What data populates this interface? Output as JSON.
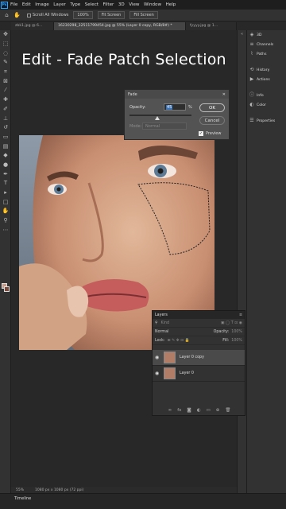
{
  "menubar": {
    "logo": "Ps",
    "items": [
      "File",
      "Edit",
      "Image",
      "Layer",
      "Type",
      "Select",
      "Filter",
      "3D",
      "View",
      "Window",
      "Help"
    ]
  },
  "options_bar": {
    "scroll_all_windows": "Scroll All Windows",
    "zoom_100": "100%",
    "fit_screen": "Fit Screen",
    "fill_screen": "Fill Screen"
  },
  "tabs": [
    {
      "label": "zbk1.jpg @ 6...",
      "active": false
    },
    {
      "label": "16230298_32511799454.jpg @ 55% (Layer 0 copy, RGB/8#) *",
      "active": true
    },
    {
      "label": "fyyyy.jpg @ 1...",
      "active": false
    }
  ],
  "overlay_title": "Edit - Fade Patch Selection",
  "fade_dialog": {
    "title": "Fade",
    "opacity_label": "Opacity:",
    "opacity_value": "45",
    "percent": "%",
    "mode_label": "Mode:",
    "mode_value": "Normal",
    "ok": "OK",
    "cancel": "Cancel",
    "preview": "Preview",
    "preview_checked": true,
    "opacity_fraction": 0.45
  },
  "panels": [
    {
      "icon": "3d-icon",
      "label": "3D"
    },
    {
      "icon": "channels-icon",
      "label": "Channels"
    },
    {
      "icon": "paths-icon",
      "label": "Paths"
    },
    {
      "icon": "history-icon",
      "label": "History"
    },
    {
      "icon": "actions-icon",
      "label": "Actions"
    },
    {
      "icon": "info-icon",
      "label": "Info"
    },
    {
      "icon": "color-icon",
      "label": "Color"
    },
    {
      "icon": "properties-icon",
      "label": "Properties"
    }
  ],
  "layers_panel": {
    "title": "Layers",
    "search_placeholder": "Kind",
    "blend_mode": "Normal",
    "opacity_label": "Opacity:",
    "opacity_value": "100%",
    "lock_label": "Lock:",
    "fill_label": "Fill:",
    "fill_value": "100%",
    "layers": [
      {
        "name": "Layer 0 copy",
        "selected": true
      },
      {
        "name": "Layer 0",
        "selected": false
      }
    ]
  },
  "status_bar": {
    "zoom": "55%",
    "doc_info": "1080 px x 1080 px (72 ppi)"
  },
  "timeline": "Timeline"
}
